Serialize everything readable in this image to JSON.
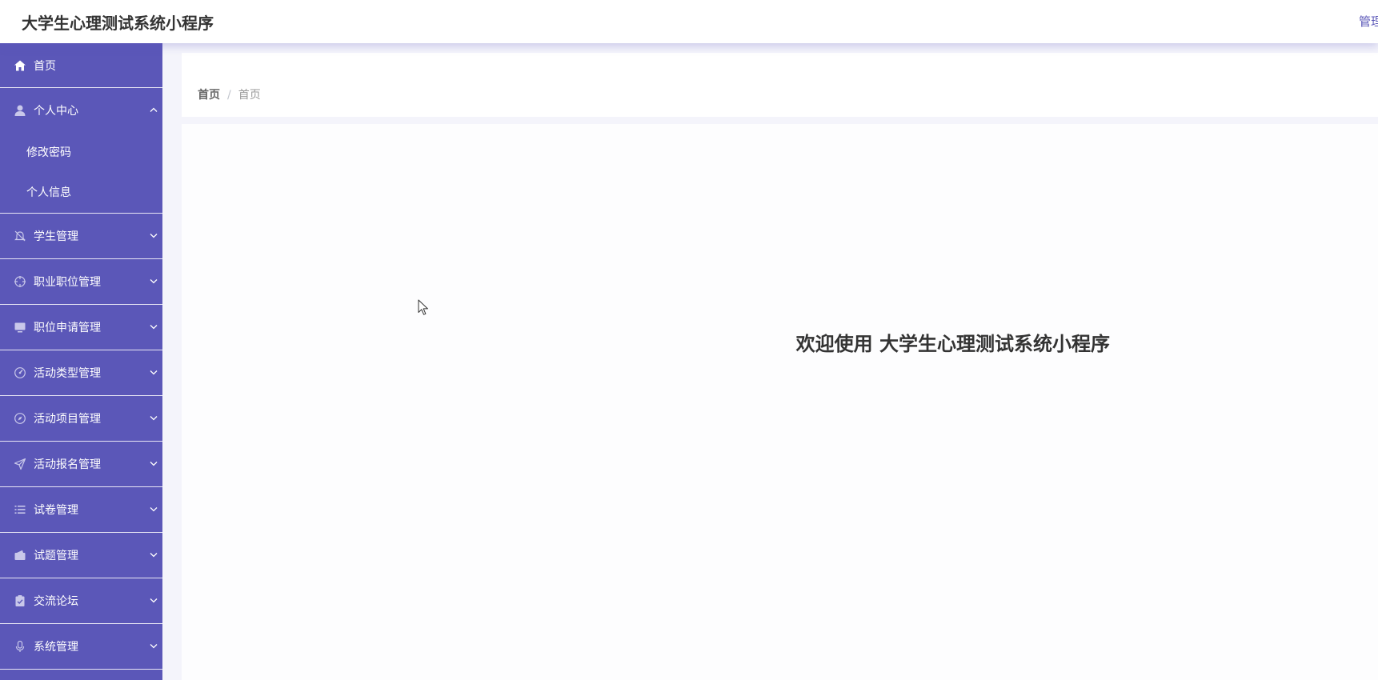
{
  "header": {
    "app_title": "大学生心理测试系统小程序",
    "right_text": "管理"
  },
  "sidebar": {
    "items": [
      {
        "label": "首页",
        "icon": "home-icon"
      },
      {
        "label": "个人中心",
        "icon": "user-icon",
        "expanded": true,
        "children": [
          {
            "label": "修改密码"
          },
          {
            "label": "个人信息"
          }
        ]
      },
      {
        "label": "学生管理",
        "icon": "bell-off-icon"
      },
      {
        "label": "职业职位管理",
        "icon": "crosshair-icon"
      },
      {
        "label": "职位申请管理",
        "icon": "monitor-icon"
      },
      {
        "label": "活动类型管理",
        "icon": "gauge-icon"
      },
      {
        "label": "活动项目管理",
        "icon": "compass-icon"
      },
      {
        "label": "活动报名管理",
        "icon": "send-icon"
      },
      {
        "label": "试卷管理",
        "icon": "list-icon"
      },
      {
        "label": "试题管理",
        "icon": "wallet-icon"
      },
      {
        "label": "交流论坛",
        "icon": "clipboard-icon"
      },
      {
        "label": "系统管理",
        "icon": "microphone-icon"
      }
    ]
  },
  "breadcrumb": {
    "home": "首页",
    "separator": "/",
    "current": "首页"
  },
  "main": {
    "welcome_prefix": "欢迎使用",
    "welcome_app": "大学生心理测试系统小程序"
  },
  "colors": {
    "sidebar_bg": "#5b57b8",
    "accent": "#5b57b8",
    "page_bg": "#f4f4fb"
  }
}
